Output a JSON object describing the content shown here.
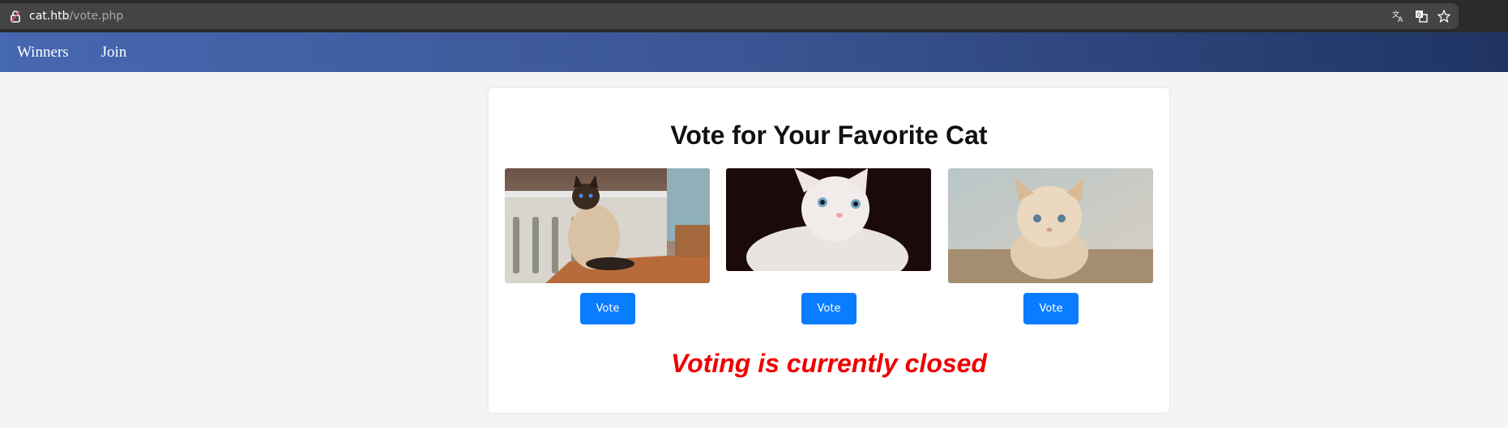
{
  "browser": {
    "url_host": "cat.htb",
    "url_path": "/vote.php"
  },
  "nav": {
    "items": [
      "Winners",
      "Join"
    ]
  },
  "vote": {
    "title": "Vote for Your Favorite Cat",
    "cats": [
      {
        "image": "siamese-cat-photo",
        "button": "Vote"
      },
      {
        "image": "white-kitten-photo",
        "button": "Vote"
      },
      {
        "image": "fluffy-kitten-photo",
        "button": "Vote"
      }
    ],
    "status": "Voting is currently closed"
  },
  "colors": {
    "nav_gradient_start": "#4667b1",
    "nav_gradient_end": "#1f3463",
    "button": "#0a7cff",
    "status": "#ee0000"
  }
}
